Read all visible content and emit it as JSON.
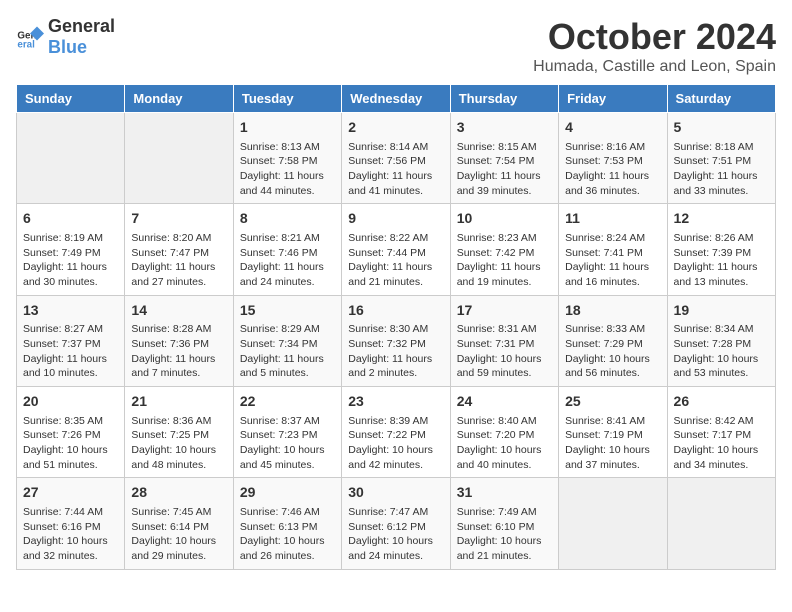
{
  "header": {
    "logo_general": "General",
    "logo_blue": "Blue",
    "month": "October 2024",
    "location": "Humada, Castille and Leon, Spain"
  },
  "weekdays": [
    "Sunday",
    "Monday",
    "Tuesday",
    "Wednesday",
    "Thursday",
    "Friday",
    "Saturday"
  ],
  "weeks": [
    [
      {
        "day": "",
        "info": ""
      },
      {
        "day": "",
        "info": ""
      },
      {
        "day": "1",
        "info": "Sunrise: 8:13 AM\nSunset: 7:58 PM\nDaylight: 11 hours and 44 minutes."
      },
      {
        "day": "2",
        "info": "Sunrise: 8:14 AM\nSunset: 7:56 PM\nDaylight: 11 hours and 41 minutes."
      },
      {
        "day": "3",
        "info": "Sunrise: 8:15 AM\nSunset: 7:54 PM\nDaylight: 11 hours and 39 minutes."
      },
      {
        "day": "4",
        "info": "Sunrise: 8:16 AM\nSunset: 7:53 PM\nDaylight: 11 hours and 36 minutes."
      },
      {
        "day": "5",
        "info": "Sunrise: 8:18 AM\nSunset: 7:51 PM\nDaylight: 11 hours and 33 minutes."
      }
    ],
    [
      {
        "day": "6",
        "info": "Sunrise: 8:19 AM\nSunset: 7:49 PM\nDaylight: 11 hours and 30 minutes."
      },
      {
        "day": "7",
        "info": "Sunrise: 8:20 AM\nSunset: 7:47 PM\nDaylight: 11 hours and 27 minutes."
      },
      {
        "day": "8",
        "info": "Sunrise: 8:21 AM\nSunset: 7:46 PM\nDaylight: 11 hours and 24 minutes."
      },
      {
        "day": "9",
        "info": "Sunrise: 8:22 AM\nSunset: 7:44 PM\nDaylight: 11 hours and 21 minutes."
      },
      {
        "day": "10",
        "info": "Sunrise: 8:23 AM\nSunset: 7:42 PM\nDaylight: 11 hours and 19 minutes."
      },
      {
        "day": "11",
        "info": "Sunrise: 8:24 AM\nSunset: 7:41 PM\nDaylight: 11 hours and 16 minutes."
      },
      {
        "day": "12",
        "info": "Sunrise: 8:26 AM\nSunset: 7:39 PM\nDaylight: 11 hours and 13 minutes."
      }
    ],
    [
      {
        "day": "13",
        "info": "Sunrise: 8:27 AM\nSunset: 7:37 PM\nDaylight: 11 hours and 10 minutes."
      },
      {
        "day": "14",
        "info": "Sunrise: 8:28 AM\nSunset: 7:36 PM\nDaylight: 11 hours and 7 minutes."
      },
      {
        "day": "15",
        "info": "Sunrise: 8:29 AM\nSunset: 7:34 PM\nDaylight: 11 hours and 5 minutes."
      },
      {
        "day": "16",
        "info": "Sunrise: 8:30 AM\nSunset: 7:32 PM\nDaylight: 11 hours and 2 minutes."
      },
      {
        "day": "17",
        "info": "Sunrise: 8:31 AM\nSunset: 7:31 PM\nDaylight: 10 hours and 59 minutes."
      },
      {
        "day": "18",
        "info": "Sunrise: 8:33 AM\nSunset: 7:29 PM\nDaylight: 10 hours and 56 minutes."
      },
      {
        "day": "19",
        "info": "Sunrise: 8:34 AM\nSunset: 7:28 PM\nDaylight: 10 hours and 53 minutes."
      }
    ],
    [
      {
        "day": "20",
        "info": "Sunrise: 8:35 AM\nSunset: 7:26 PM\nDaylight: 10 hours and 51 minutes."
      },
      {
        "day": "21",
        "info": "Sunrise: 8:36 AM\nSunset: 7:25 PM\nDaylight: 10 hours and 48 minutes."
      },
      {
        "day": "22",
        "info": "Sunrise: 8:37 AM\nSunset: 7:23 PM\nDaylight: 10 hours and 45 minutes."
      },
      {
        "day": "23",
        "info": "Sunrise: 8:39 AM\nSunset: 7:22 PM\nDaylight: 10 hours and 42 minutes."
      },
      {
        "day": "24",
        "info": "Sunrise: 8:40 AM\nSunset: 7:20 PM\nDaylight: 10 hours and 40 minutes."
      },
      {
        "day": "25",
        "info": "Sunrise: 8:41 AM\nSunset: 7:19 PM\nDaylight: 10 hours and 37 minutes."
      },
      {
        "day": "26",
        "info": "Sunrise: 8:42 AM\nSunset: 7:17 PM\nDaylight: 10 hours and 34 minutes."
      }
    ],
    [
      {
        "day": "27",
        "info": "Sunrise: 7:44 AM\nSunset: 6:16 PM\nDaylight: 10 hours and 32 minutes."
      },
      {
        "day": "28",
        "info": "Sunrise: 7:45 AM\nSunset: 6:14 PM\nDaylight: 10 hours and 29 minutes."
      },
      {
        "day": "29",
        "info": "Sunrise: 7:46 AM\nSunset: 6:13 PM\nDaylight: 10 hours and 26 minutes."
      },
      {
        "day": "30",
        "info": "Sunrise: 7:47 AM\nSunset: 6:12 PM\nDaylight: 10 hours and 24 minutes."
      },
      {
        "day": "31",
        "info": "Sunrise: 7:49 AM\nSunset: 6:10 PM\nDaylight: 10 hours and 21 minutes."
      },
      {
        "day": "",
        "info": ""
      },
      {
        "day": "",
        "info": ""
      }
    ]
  ]
}
